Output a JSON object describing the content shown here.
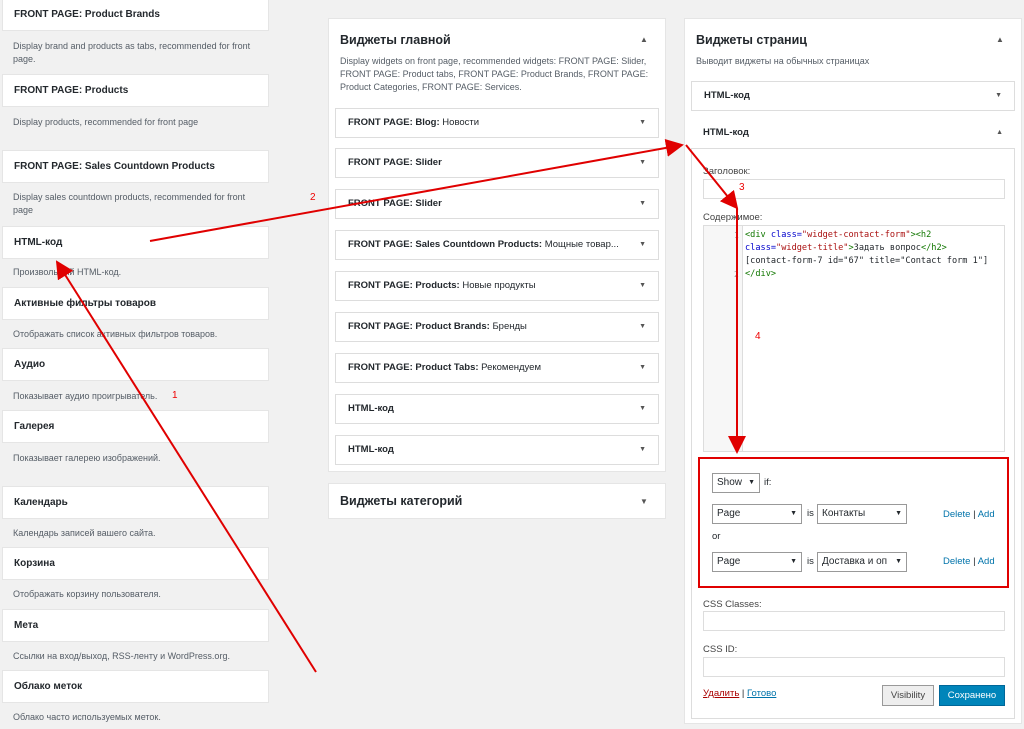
{
  "available_widgets": [
    {
      "title": "FRONT PAGE: Product Brands",
      "desc": "Display brand and products as tabs, recommended for front page."
    },
    {
      "title": "FRONT PAGE: Products",
      "desc": "Display products, recommended for front page"
    },
    {
      "title": "FRONT PAGE: Sales Countdown Products",
      "desc": "Display sales countdown products, recommended for front page"
    },
    {
      "title": "HTML-код",
      "desc": "Произвольный HTML-код."
    },
    {
      "title": "Активные фильтры товаров",
      "desc": "Отображать список активных фильтров товаров."
    },
    {
      "title": "Аудио",
      "desc": "Показывает аудио проигрыватель."
    },
    {
      "title": "Галерея",
      "desc": "Показывает галерею изображений."
    },
    {
      "title": "Календарь",
      "desc": "Календарь записей вашего сайта."
    },
    {
      "title": "Корзина",
      "desc": "Отображать корзину пользователя."
    },
    {
      "title": "Мета",
      "desc": "Ссылки на вход/выход, RSS-ленту и WordPress.org."
    },
    {
      "title": "Облако меток",
      "desc": "Облако часто используемых меток."
    }
  ],
  "main_sidebar": {
    "title": "Виджеты главной",
    "desc": "Display widgets on front page, recommended widgets: FRONT PAGE: Slider, FRONT PAGE: Product tabs, FRONT PAGE: Product Brands, FRONT PAGE: Product Categories, FRONT PAGE: Services.",
    "items": [
      {
        "name": "FRONT PAGE: Blog:",
        "sub": " Новости"
      },
      {
        "name": "FRONT PAGE: Slider",
        "sub": ""
      },
      {
        "name": "FRONT PAGE: Slider",
        "sub": ""
      },
      {
        "name": "FRONT PAGE: Sales Countdown Products:",
        "sub": " Мощные товар..."
      },
      {
        "name": "FRONT PAGE: Products:",
        "sub": " Новые продукты"
      },
      {
        "name": "FRONT PAGE: Product Brands:",
        "sub": " Бренды"
      },
      {
        "name": "FRONT PAGE: Product Tabs:",
        "sub": " Рекомендуем"
      },
      {
        "name": "HTML-код",
        "sub": ""
      },
      {
        "name": "HTML-код",
        "sub": ""
      }
    ]
  },
  "category_sidebar": {
    "title": "Виджеты категорий"
  },
  "page_sidebar": {
    "title": "Виджеты страниц",
    "desc": "Выводит виджеты на обычных страницах",
    "collapsed_item": "HTML-код",
    "open_item": "HTML-код",
    "title_label": "Заголовок:",
    "content_label": "Содержимое:",
    "code_line_1": "1",
    "code_line_2": "2",
    "code": {
      "t1": "<div",
      "a1": " class=",
      "s1": "\"widget-contact-form\"",
      "t2": "><h2",
      "a2": "class=",
      "s2": "\"widget-title\"",
      "t3": ">",
      "txt1": "Задать вопрос",
      "t4": "</h2>",
      "txt2": "[contact-form-7 id=\"67\" title=\"Contact form 1\"]",
      "t5": "</div>"
    },
    "visibility": {
      "action": "Show",
      "if": "if:",
      "rule1_type": "Page",
      "rule1_is": "is",
      "rule1_value": "Контакты",
      "or": "or",
      "rule2_type": "Page",
      "rule2_is": "is",
      "rule2_value": "Доставка и оп",
      "delete": "Delete",
      "sep": " | ",
      "add": "Add"
    },
    "css_classes_label": "CSS Classes:",
    "css_id_label": "CSS ID:",
    "delete_link": "Удалить",
    "sep": " | ",
    "done_link": "Готово",
    "visibility_button": "Visibility",
    "save_button": "Сохранено"
  },
  "annotations": {
    "n1": "1",
    "n2": "2",
    "n3": "3",
    "n4": "4"
  },
  "colors": {
    "accent": "#0085ba",
    "annotation": "#e00000",
    "link": "#0073aa"
  }
}
